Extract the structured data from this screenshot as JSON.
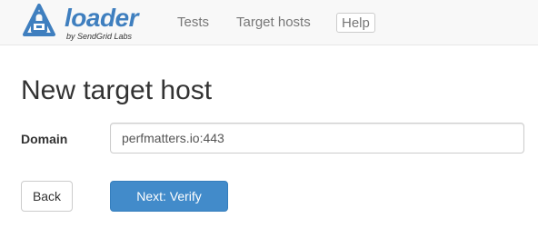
{
  "brand": {
    "name": "loader",
    "tagline": "by SendGrid Labs",
    "logo_icon": "lock-box-icon",
    "accent_color": "#3f7fbf"
  },
  "nav": {
    "tests_label": "Tests",
    "target_hosts_label": "Target hosts",
    "help_label": "Help"
  },
  "main": {
    "title": "New target host",
    "domain_field": {
      "label": "Domain",
      "value": "perfmatters.io:443"
    },
    "back_label": "Back",
    "next_label": "Next: Verify",
    "primary_color": "#428bca"
  }
}
